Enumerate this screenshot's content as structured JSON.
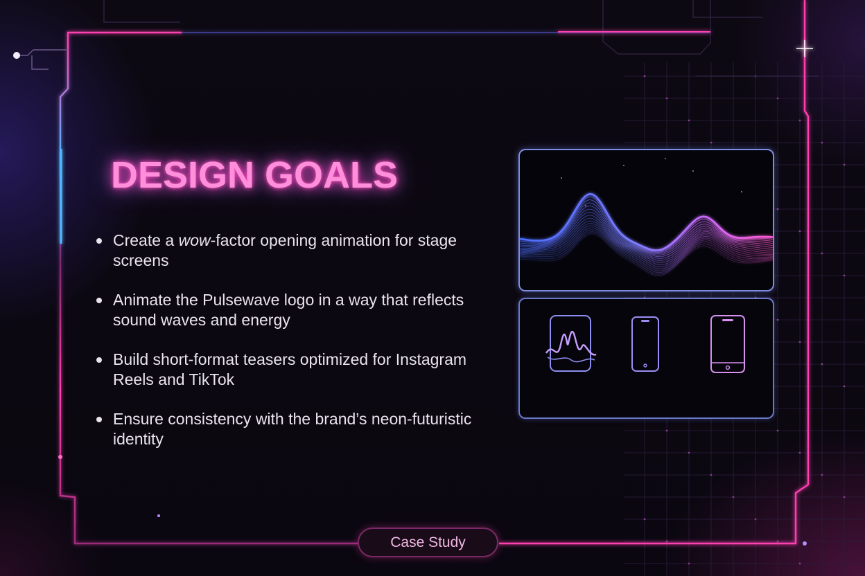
{
  "slide": {
    "title": "DESIGN GOALS",
    "goals": [
      {
        "prefix": "Create a ",
        "emphasis": "wow",
        "text": "-factor opening animation for stage screens"
      },
      {
        "text": "Animate the Pulsewave logo in a way that reflects sound waves and energy"
      },
      {
        "text": "Build short-format teasers optimized for Instagram Reels and TikTok"
      },
      {
        "text": "Ensure consistency with the brand’s neon-futuristic identity"
      }
    ],
    "badge": "Case Study"
  },
  "visuals": {
    "wave_panel": "abstract-neon-sound-wave",
    "device_icons": [
      "waveform-card-icon",
      "smartphone-icon",
      "tablet-icon"
    ]
  },
  "colors": {
    "background": "#0b0710",
    "title_glow": "#ff8fdb",
    "frame_pink": "#ff3fb0",
    "frame_blue": "#4fb8ff",
    "panel_border": "#7c8de0",
    "text": "#e9e4ee"
  }
}
